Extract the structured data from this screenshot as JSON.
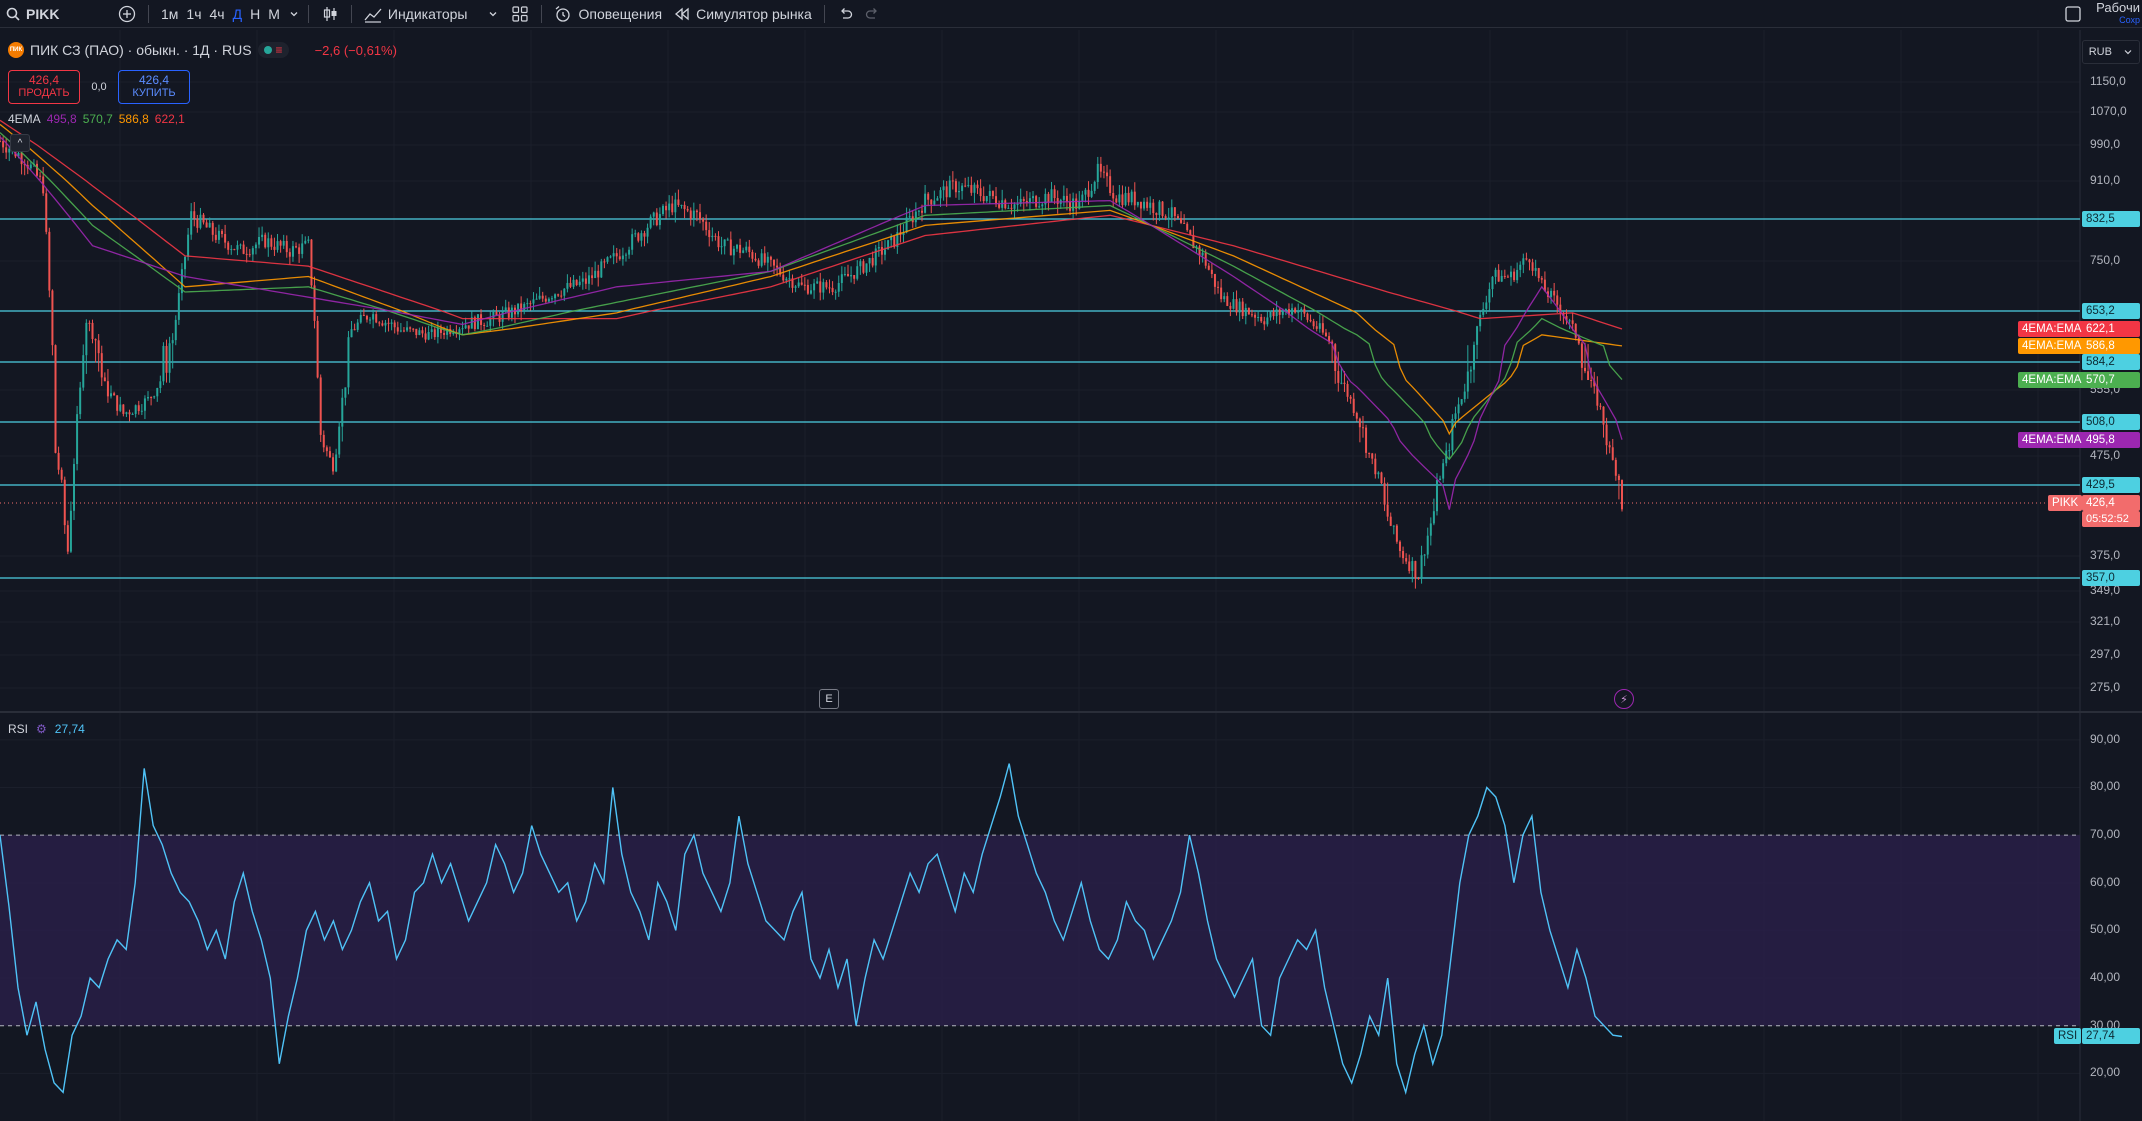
{
  "toolbar": {
    "symbol": "PIKK",
    "intervals": [
      {
        "label": "1м",
        "active": false
      },
      {
        "label": "1ч",
        "active": false
      },
      {
        "label": "4ч",
        "active": false
      },
      {
        "label": "Д",
        "active": true
      },
      {
        "label": "Н",
        "active": false
      },
      {
        "label": "М",
        "active": false
      }
    ],
    "indicators_label": "Индикаторы",
    "alerts_label": "Оповещения",
    "replay_label": "Симулятор рынка",
    "workspace_label": "Рабочи",
    "workspace_sub": "Сохр"
  },
  "legend": {
    "title": "ПИК СЗ (ПАО) · обыкн. · 1Д · RUS",
    "logo_text": "ПИК",
    "change": "−2,6 (−0,61%)",
    "sell_price": "426,4",
    "sell_label": "ПРОДАТЬ",
    "spread": "0,0",
    "buy_price": "426,4",
    "buy_label": "КУПИТЬ",
    "ema_name": "4EMA",
    "ema_values": [
      {
        "value": "495,8",
        "color": "#9c27b0"
      },
      {
        "value": "570,7",
        "color": "#4caf50"
      },
      {
        "value": "586,8",
        "color": "#ff9800"
      },
      {
        "value": "622,1",
        "color": "#f23645"
      }
    ],
    "collapse": "^",
    "currency": "RUB"
  },
  "rsi_legend": {
    "name": "RSI",
    "value": "27,74"
  },
  "markers": {
    "earnings": "E",
    "flash": "⚡"
  },
  "colors": {
    "background": "#131722",
    "up": "#26a69a",
    "down": "#ef5350",
    "hline": "#4dd0e1",
    "rsi_line": "#4fc3f7",
    "rsi_band": "#2a1f4a",
    "last_price": "#f26c6c"
  },
  "chart_data": [
    {
      "type": "candlestick",
      "title": "ПИК СЗ (ПАО) · обыкн. · 1Д · RUS",
      "y_ticks": [
        {
          "value": 1150,
          "label": "1150,0"
        },
        {
          "value": 1070,
          "label": "1070,0"
        },
        {
          "value": 990,
          "label": "990,0"
        },
        {
          "value": 910,
          "label": "910,0"
        },
        {
          "value": 750,
          "label": "750,0"
        },
        {
          "value": 555,
          "label": "555,0"
        },
        {
          "value": 475,
          "label": "475,0"
        },
        {
          "value": 375,
          "label": "375,0"
        },
        {
          "value": 349,
          "label": "349,0"
        },
        {
          "value": 321,
          "label": "321,0"
        },
        {
          "value": 297,
          "label": "297,0"
        },
        {
          "value": 275,
          "label": "275,0"
        }
      ],
      "horizontal_levels": [
        {
          "value": 832.5,
          "label": "832,5"
        },
        {
          "value": 653.2,
          "label": "653,2"
        },
        {
          "value": 584.2,
          "label": "584,2"
        },
        {
          "value": 508.0,
          "label": "508,0"
        },
        {
          "value": 429.5,
          "label": "429,5"
        },
        {
          "value": 357.0,
          "label": "357,0"
        }
      ],
      "ema_tags": [
        {
          "name": "4EMA:EMA",
          "value": "622,1",
          "color": "#f23645"
        },
        {
          "name": "4EMA:EMA",
          "value": "586,8",
          "color": "#ff9800"
        },
        {
          "name": "4EMA:EMA",
          "value": "570,7",
          "color": "#4caf50"
        },
        {
          "name": "4EMA:EMA",
          "value": "495,8",
          "color": "#9c27b0"
        }
      ],
      "last_price": {
        "symbol": "PIKK",
        "value": "426,4",
        "countdown": "05:52:52"
      },
      "close_path": [
        [
          0,
          1000
        ],
        [
          8,
          960
        ],
        [
          14,
          900
        ],
        [
          18,
          480
        ],
        [
          22,
          380
        ],
        [
          28,
          640
        ],
        [
          34,
          560
        ],
        [
          40,
          520
        ],
        [
          48,
          540
        ],
        [
          56,
          600
        ],
        [
          62,
          840
        ],
        [
          70,
          800
        ],
        [
          78,
          770
        ],
        [
          86,
          790
        ],
        [
          94,
          770
        ],
        [
          100,
          780
        ],
        [
          104,
          500
        ],
        [
          108,
          460
        ],
        [
          114,
          620
        ],
        [
          120,
          650
        ],
        [
          130,
          620
        ],
        [
          140,
          610
        ],
        [
          150,
          630
        ],
        [
          160,
          640
        ],
        [
          170,
          660
        ],
        [
          180,
          690
        ],
        [
          190,
          710
        ],
        [
          200,
          760
        ],
        [
          210,
          820
        ],
        [
          218,
          860
        ],
        [
          226,
          840
        ],
        [
          234,
          780
        ],
        [
          242,
          770
        ],
        [
          250,
          740
        ],
        [
          260,
          700
        ],
        [
          270,
          700
        ],
        [
          280,
          740
        ],
        [
          290,
          790
        ],
        [
          300,
          870
        ],
        [
          310,
          900
        ],
        [
          320,
          880
        ],
        [
          330,
          860
        ],
        [
          340,
          880
        ],
        [
          350,
          860
        ],
        [
          356,
          930
        ],
        [
          362,
          880
        ],
        [
          370,
          870
        ],
        [
          380,
          840
        ],
        [
          390,
          760
        ],
        [
          396,
          680
        ],
        [
          402,
          660
        ],
        [
          410,
          640
        ],
        [
          420,
          660
        ],
        [
          428,
          620
        ],
        [
          436,
          560
        ],
        [
          442,
          500
        ],
        [
          448,
          430
        ],
        [
          454,
          380
        ],
        [
          460,
          360
        ],
        [
          466,
          430
        ],
        [
          472,
          520
        ],
        [
          478,
          600
        ],
        [
          484,
          720
        ],
        [
          490,
          720
        ],
        [
          496,
          760
        ],
        [
          500,
          700
        ],
        [
          506,
          660
        ],
        [
          512,
          600
        ],
        [
          518,
          540
        ],
        [
          522,
          480
        ],
        [
          526,
          426
        ]
      ],
      "ema_paths": [
        {
          "name": "EMA 622,1",
          "color": "#f23645",
          "points": [
            [
              0,
              1050
            ],
            [
              30,
              900
            ],
            [
              60,
              760
            ],
            [
              100,
              740
            ],
            [
              150,
              640
            ],
            [
              200,
              640
            ],
            [
              250,
              700
            ],
            [
              300,
              800
            ],
            [
              360,
              840
            ],
            [
              400,
              780
            ],
            [
              450,
              690
            ],
            [
              480,
              640
            ],
            [
              510,
              650
            ],
            [
              526,
              622
            ]
          ]
        },
        {
          "name": "EMA 586,8",
          "color": "#ff9800",
          "points": [
            [
              0,
              1040
            ],
            [
              30,
              860
            ],
            [
              60,
              700
            ],
            [
              100,
              720
            ],
            [
              150,
              610
            ],
            [
              200,
              650
            ],
            [
              250,
              720
            ],
            [
              300,
              820
            ],
            [
              360,
              850
            ],
            [
              400,
              760
            ],
            [
              440,
              650
            ],
            [
              470,
              500
            ],
            [
              500,
              610
            ],
            [
              526,
              587
            ]
          ]
        },
        {
          "name": "EMA 570,7",
          "color": "#4caf50",
          "points": [
            [
              0,
              1020
            ],
            [
              30,
              820
            ],
            [
              60,
              690
            ],
            [
              100,
              700
            ],
            [
              150,
              610
            ],
            [
              200,
              670
            ],
            [
              250,
              730
            ],
            [
              300,
              840
            ],
            [
              360,
              860
            ],
            [
              400,
              740
            ],
            [
              440,
              610
            ],
            [
              470,
              470
            ],
            [
              500,
              640
            ],
            [
              526,
              571
            ]
          ]
        },
        {
          "name": "EMA 495,8",
          "color": "#9c27b0",
          "points": [
            [
              0,
              1010
            ],
            [
              30,
              780
            ],
            [
              60,
              720
            ],
            [
              100,
              680
            ],
            [
              150,
              630
            ],
            [
              200,
              700
            ],
            [
              250,
              730
            ],
            [
              300,
              860
            ],
            [
              360,
              870
            ],
            [
              400,
              720
            ],
            [
              440,
              560
            ],
            [
              470,
              420
            ],
            [
              500,
              700
            ],
            [
              526,
              496
            ]
          ]
        }
      ]
    },
    {
      "type": "line",
      "name": "RSI",
      "last_value": "27,74",
      "ylim": [
        10,
        95
      ],
      "upper_band": 70,
      "lower_band": 30,
      "y_ticks": [
        {
          "value": 90,
          "label": "90,00"
        },
        {
          "value": 80,
          "label": "80,00"
        },
        {
          "value": 70,
          "label": "70,00"
        },
        {
          "value": 60,
          "label": "60,00"
        },
        {
          "value": 50,
          "label": "50,00"
        },
        {
          "value": 40,
          "label": "40,00"
        },
        {
          "value": 30,
          "label": "30,00"
        },
        {
          "value": 20,
          "label": "20,00"
        }
      ],
      "values": [
        70,
        55,
        38,
        28,
        35,
        25,
        18,
        16,
        28,
        32,
        40,
        38,
        44,
        48,
        46,
        60,
        84,
        72,
        68,
        62,
        58,
        56,
        52,
        46,
        50,
        44,
        56,
        62,
        54,
        48,
        40,
        22,
        32,
        40,
        50,
        54,
        48,
        52,
        46,
        50,
        56,
        60,
        52,
        54,
        44,
        48,
        58,
        60,
        66,
        60,
        64,
        58,
        52,
        56,
        60,
        68,
        64,
        58,
        62,
        72,
        66,
        62,
        58,
        60,
        52,
        56,
        64,
        60,
        80,
        66,
        58,
        54,
        48,
        60,
        56,
        50,
        66,
        70,
        62,
        58,
        54,
        60,
        74,
        64,
        58,
        52,
        50,
        48,
        54,
        58,
        44,
        40,
        46,
        38,
        44,
        30,
        40,
        48,
        44,
        50,
        56,
        62,
        58,
        64,
        66,
        60,
        54,
        62,
        58,
        66,
        72,
        78,
        85,
        74,
        68,
        62,
        58,
        52,
        48,
        54,
        60,
        52,
        46,
        44,
        48,
        56,
        52,
        50,
        44,
        48,
        52,
        58,
        70,
        62,
        52,
        44,
        40,
        36,
        40,
        44,
        30,
        28,
        40,
        44,
        48,
        46,
        50,
        38,
        30,
        22,
        18,
        24,
        32,
        28,
        40,
        22,
        16,
        24,
        30,
        22,
        28,
        44,
        60,
        70,
        74,
        80,
        78,
        72,
        60,
        70,
        74,
        58,
        50,
        44,
        38,
        46,
        40,
        32,
        30,
        28,
        27.74
      ]
    }
  ]
}
